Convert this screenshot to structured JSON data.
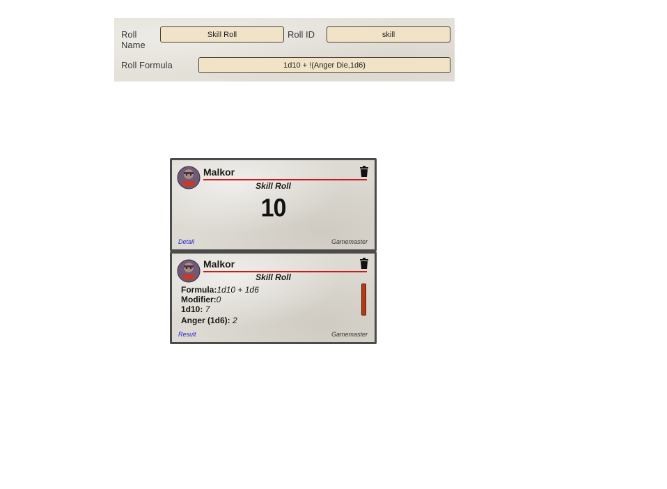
{
  "config": {
    "roll_name_label": "Roll\nName",
    "roll_name_value": "Skill Roll",
    "roll_id_label": "Roll ID",
    "roll_id_value": "skill",
    "roll_formula_label": "Roll Formula",
    "roll_formula_value": "1d10 + !(Anger Die,1d6)"
  },
  "cards": [
    {
      "speaker": "Malkor",
      "flavor": "Skill Roll",
      "total": "10",
      "link": "Detail",
      "user": "Gamemaster"
    },
    {
      "speaker": "Malkor",
      "flavor": "Skill Roll",
      "details": [
        {
          "key": "Formula:",
          "value": "1d10 + 1d6"
        },
        {
          "key": "Modifier:",
          "value": "0"
        },
        {
          "key": "1d10:",
          "value": "7"
        },
        {
          "key": "Anger (1d6):",
          "value": "2"
        }
      ],
      "link": "Result",
      "user": "Gamemaster"
    }
  ],
  "colors": {
    "name_rule": "#cc1a1a",
    "link": "#1f1fcc",
    "input_bg": "#f0e3c8",
    "die_bar": "#b33a12"
  },
  "icons": {
    "avatar": "dwarf-portrait-icon",
    "delete": "trash-icon"
  }
}
